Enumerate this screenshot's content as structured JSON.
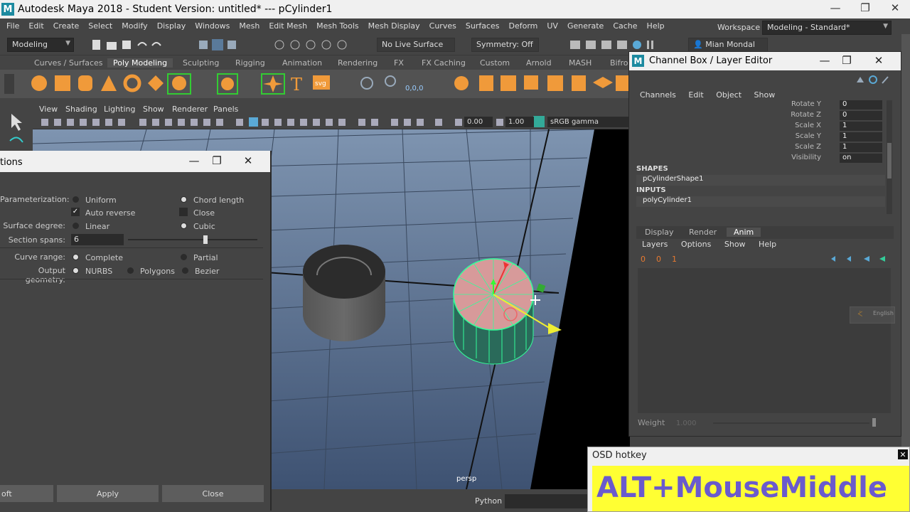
{
  "window": {
    "title": "Autodesk Maya 2018 - Student Version: untitled*   ---   pCylinder1",
    "minimize": "—",
    "maximize": "❐",
    "close": "✕"
  },
  "menubar": [
    "File",
    "Edit",
    "Create",
    "Select",
    "Modify",
    "Display",
    "Windows",
    "Mesh",
    "Edit Mesh",
    "Mesh Tools",
    "Mesh Display",
    "Curves",
    "Surfaces",
    "Deform",
    "UV",
    "Generate",
    "Cache",
    "Help"
  ],
  "statusline": {
    "menuset": "Modeling",
    "live_surface": "No Live Surface",
    "symmetry": "Symmetry: Off",
    "user": "Mian Mondal",
    "workspace_label": "Workspace :",
    "workspace_value": "Modeling - Standard*"
  },
  "shelf": {
    "tabs": [
      "Curves / Surfaces",
      "Poly Modeling",
      "Sculpting",
      "Rigging",
      "Animation",
      "Rendering",
      "FX",
      "FX Caching",
      "Custom",
      "Arnold",
      "MASH",
      "Bifro"
    ],
    "active_tab": "Poly Modeling",
    "svg_label": "svg",
    "text_label": "T",
    "coords_label": "0,0,0"
  },
  "viewport": {
    "menu": [
      "View",
      "Shading",
      "Lighting",
      "Show",
      "Renderer",
      "Panels"
    ],
    "near_value": "0.00",
    "far_value": "1.00",
    "color_space": "sRGB gamma",
    "camera": "persp"
  },
  "dialog": {
    "title": "tions",
    "parameterization_label": "Parameterization:",
    "uniform": "Uniform",
    "chord_length": "Chord length",
    "auto_reverse": "Auto reverse",
    "close_opt": "Close",
    "surface_degree_label": "Surface degree:",
    "linear": "Linear",
    "cubic": "Cubic",
    "section_spans_label": "Section spans:",
    "section_spans_value": "6",
    "curve_range_label": "Curve range:",
    "complete": "Complete",
    "partial": "Partial",
    "output_geometry_label": "Output geometry:",
    "nurbs": "NURBS",
    "polygons": "Polygons",
    "bezier": "Bezier",
    "btn_loft": "oft",
    "btn_apply": "Apply",
    "btn_close": "Close",
    "section_spans_fraction": 0.6
  },
  "channelbox": {
    "title": "Channel Box / Layer Editor",
    "menu": [
      "Channels",
      "Edit",
      "Object",
      "Show"
    ],
    "attributes": [
      {
        "name": "Rotate Y",
        "value": "0"
      },
      {
        "name": "Rotate Z",
        "value": "0"
      },
      {
        "name": "Scale X",
        "value": "1"
      },
      {
        "name": "Scale Y",
        "value": "1"
      },
      {
        "name": "Scale Z",
        "value": "1"
      },
      {
        "name": "Visibility",
        "value": "on"
      }
    ],
    "shapes_label": "SHAPES",
    "shape_node": "pCylinderShape1",
    "inputs_label": "INPUTS",
    "input_node": "polyCylinder1",
    "layer_tabs": [
      "Display",
      "Render",
      "Anim"
    ],
    "active_layer_tab": "Anim",
    "layer_menu": [
      "Layers",
      "Options",
      "Show",
      "Help"
    ],
    "weight_label": "Weight",
    "weight_value": "1.000",
    "keyboard_lang": "English"
  },
  "osd": {
    "title": "OSD hotkey",
    "hotkey": "ALT+MouseMiddle"
  },
  "bottom": {
    "python_label": "Python"
  },
  "colors": {
    "accent": "#5aa9d6",
    "osd_bg": "#ffff33",
    "osd_text": "#6a5acd",
    "selection": "#33ff99"
  }
}
